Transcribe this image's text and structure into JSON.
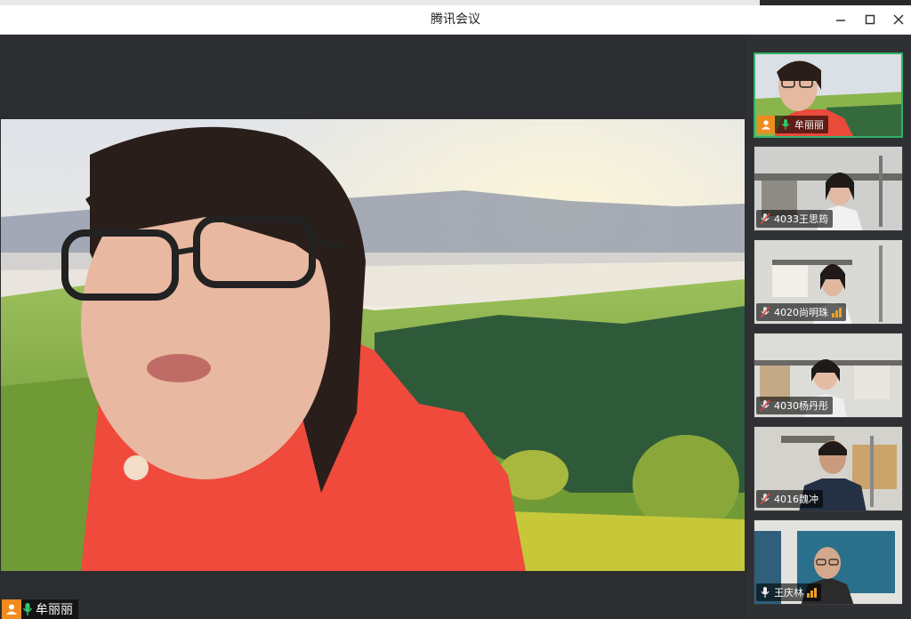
{
  "window": {
    "title": "腾讯会议"
  },
  "main_speaker": {
    "name": "牟丽丽"
  },
  "participants": [
    {
      "name": "牟丽丽",
      "mic": "on",
      "active": true
    },
    {
      "name": "4033王思筠",
      "mic": "muted",
      "active": false
    },
    {
      "name": "4020尚明珠",
      "mic": "muted",
      "active": false
    },
    {
      "name": "4030杨丹彤",
      "mic": "muted",
      "active": false
    },
    {
      "name": "4016魏冲",
      "mic": "muted",
      "active": false
    },
    {
      "name": "王庆林",
      "mic": "on",
      "active": false
    }
  ],
  "colors": {
    "accent_active": "#35b06a",
    "avatar_badge": "#f08c1e",
    "mic_on": "#35c46a",
    "volume": "#f0a020"
  },
  "icons": [
    "minimize-icon",
    "maximize-icon",
    "close-icon",
    "microphone-icon",
    "microphone-muted-icon",
    "person-icon",
    "volume-bars-icon"
  ]
}
